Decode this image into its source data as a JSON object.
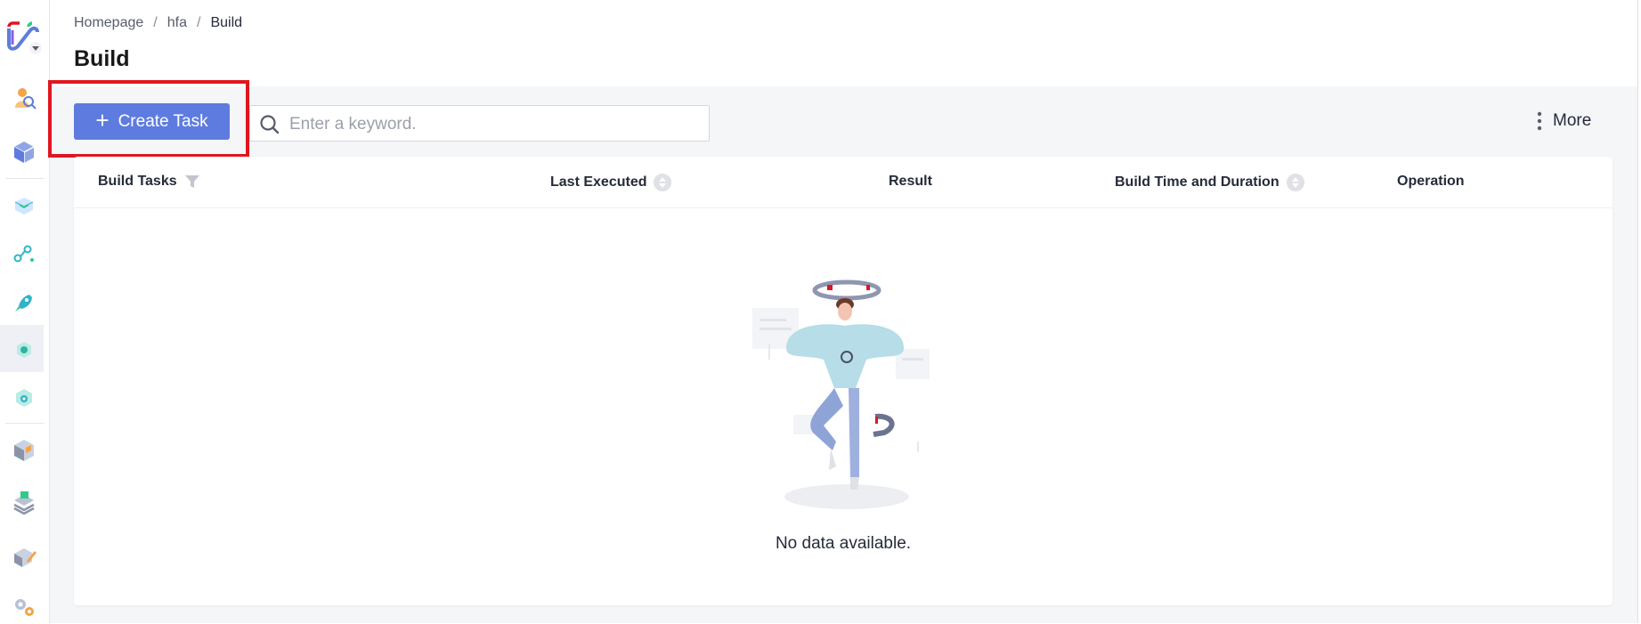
{
  "breadcrumb": {
    "items": [
      "Homepage",
      "hfa"
    ],
    "current": "Build",
    "separator": "/"
  },
  "page_title": "Build",
  "toolbar": {
    "create_label": "Create Task",
    "create_icon": "plus-icon",
    "search_placeholder": "Enter a keyword.",
    "search_value": "",
    "more_label": "More",
    "more_icon": "vertical-ellipsis-icon"
  },
  "table": {
    "columns": [
      {
        "label": "Build Tasks",
        "icon": "filter-icon"
      },
      {
        "label": "Last Executed",
        "icon": "sort-icon"
      },
      {
        "label": "Result"
      },
      {
        "label": "Build Time and Duration",
        "icon": "sort-icon"
      },
      {
        "label": "Operation"
      }
    ],
    "rows": [],
    "empty_text": "No data available."
  },
  "sidebar": {
    "logo": "app-logo-icon",
    "icons": [
      "person-search-icon",
      "package-icon",
      "code-cube-icon",
      "pipeline-flow-icon",
      "rocket-icon",
      "build-gear-icon",
      "cloud-settings-icon",
      "artifact-box-icon",
      "layer-stack-icon",
      "edit-docs-icon",
      "settings-gear-icon"
    ],
    "active_index": 5
  },
  "colors": {
    "primary": "#5e7ce0",
    "highlight": "#e0161f",
    "content_bg": "#f5f6f8",
    "sidebar_active": "#eef0f6"
  }
}
